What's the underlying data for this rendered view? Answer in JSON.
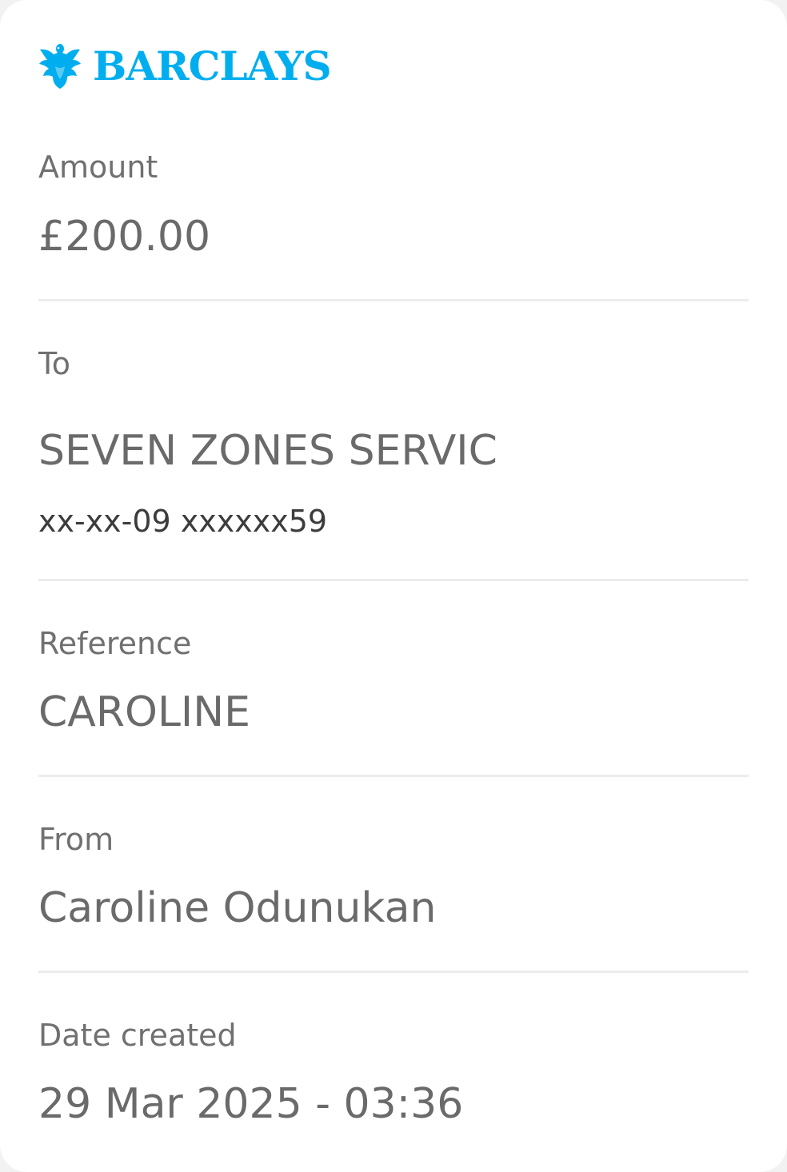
{
  "brand": {
    "name": "BARCLAYS",
    "color": "#00aeef",
    "icon": "eagle-icon"
  },
  "amount": {
    "label": "Amount",
    "value": "£200.00"
  },
  "to": {
    "label": "To",
    "name": "SEVEN ZONES SERVIC",
    "account": "xx-xx-09 xxxxxx59"
  },
  "reference": {
    "label": "Reference",
    "value": "CAROLINE"
  },
  "from": {
    "label": "From",
    "value": "Caroline Odunukan"
  },
  "date_created": {
    "label": "Date created",
    "value": "29 Mar 2025 - 03:36"
  }
}
